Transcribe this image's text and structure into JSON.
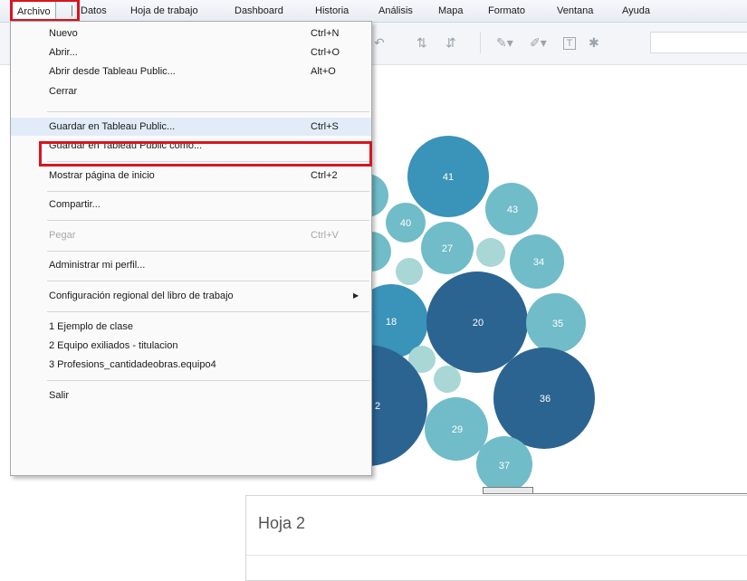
{
  "menubar": {
    "items": [
      "Archivo",
      "Datos",
      "Hoja de trabajo",
      "Dashboard",
      "Historia",
      "Análisis",
      "Mapa",
      "Formato",
      "Ventana",
      "Ayuda"
    ]
  },
  "file_menu": {
    "items": [
      {
        "label": "Nuevo",
        "shortcut": "Ctrl+N"
      },
      {
        "label": "Abrir...",
        "shortcut": "Ctrl+O"
      },
      {
        "label": "Abrir desde Tableau Public...",
        "shortcut": "Alt+O"
      },
      {
        "label": "Cerrar",
        "shortcut": ""
      },
      {
        "label": "Guardar en Tableau Public...",
        "shortcut": "Ctrl+S"
      },
      {
        "label": "Guardar en Tableau Public como...",
        "shortcut": ""
      },
      {
        "label": "Mostrar página de inicio",
        "shortcut": "Ctrl+2"
      },
      {
        "label": "Compartir...",
        "shortcut": ""
      },
      {
        "label": "Pegar",
        "shortcut": "Ctrl+V",
        "disabled": true
      },
      {
        "label": "Administrar mi perfil...",
        "shortcut": ""
      },
      {
        "label": "Configuración regional del libro de trabajo",
        "shortcut": "",
        "submenu": true
      },
      {
        "label": "1 Ejemplo de clase",
        "shortcut": ""
      },
      {
        "label": "2 Equipo exiliados - titulacion",
        "shortcut": ""
      },
      {
        "label": "3 Profesions_cantidadeobras.equipo4",
        "shortcut": ""
      },
      {
        "label": "Salir",
        "shortcut": ""
      }
    ]
  },
  "bubbles": {
    "labels": [
      "41",
      "40",
      "43",
      "27",
      "34",
      "18",
      "20",
      "35",
      "2",
      "36",
      "29",
      "37"
    ],
    "colors": {
      "dark": "#2b6491",
      "medium": "#3a93b8",
      "teal": "#70bcc8",
      "light": "#a8d7d5"
    }
  },
  "sheet2": {
    "title": "Hoja 2"
  },
  "toolbar_icons": [
    "undo-icon",
    "sort-asc-icon",
    "sort-desc-icon",
    "highlight-icon",
    "format-icon",
    "text-label-icon",
    "pin-icon"
  ]
}
